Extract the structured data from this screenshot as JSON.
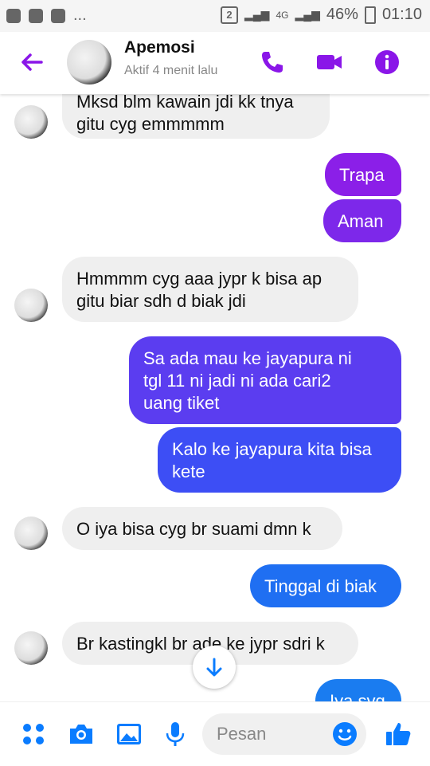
{
  "status": {
    "sim_badge": "2",
    "network": "4G",
    "battery": "46%",
    "time": "01:10",
    "notif_more": "..."
  },
  "header": {
    "name": "Apemosi",
    "status": "Aktif 4 menit lalu"
  },
  "messages": [
    {
      "text": "Mksd blm kawain jdi kk tnya\ngitu cyg emmmmm",
      "dir": "in"
    },
    {
      "text": "Trapa",
      "dir": "out",
      "color": "#8b1fe8"
    },
    {
      "text": "Aman",
      "dir": "out",
      "color": "#7d28ea"
    },
    {
      "text": "Hmmmm cyg aaa jypr k bisa ap\ngitu biar sdh d biak jdi",
      "dir": "in"
    },
    {
      "text": "Sa ada mau ke jayapura ni\ntgl 11 ni jadi ni ada cari2\nuang tiket",
      "dir": "out",
      "color": "#5b3df0"
    },
    {
      "text": "Kalo ke jayapura kita bisa\nkete",
      "dir": "out",
      "color": "#3d4ef5"
    },
    {
      "text": "O iya bisa cyg br suami dmn k",
      "dir": "in"
    },
    {
      "text": "Tinggal di biak",
      "dir": "out",
      "color": "#1f6ff2"
    },
    {
      "text": "Br kastingkl br ade ke jypr sdri k",
      "dir": "in"
    },
    {
      "text": "Iya syg",
      "dir": "out",
      "color": "#1a7cf0"
    }
  ],
  "composer": {
    "placeholder": "Pesan"
  },
  "colors": {
    "accent": "#8a16e8",
    "blue": "#0a7cff"
  }
}
